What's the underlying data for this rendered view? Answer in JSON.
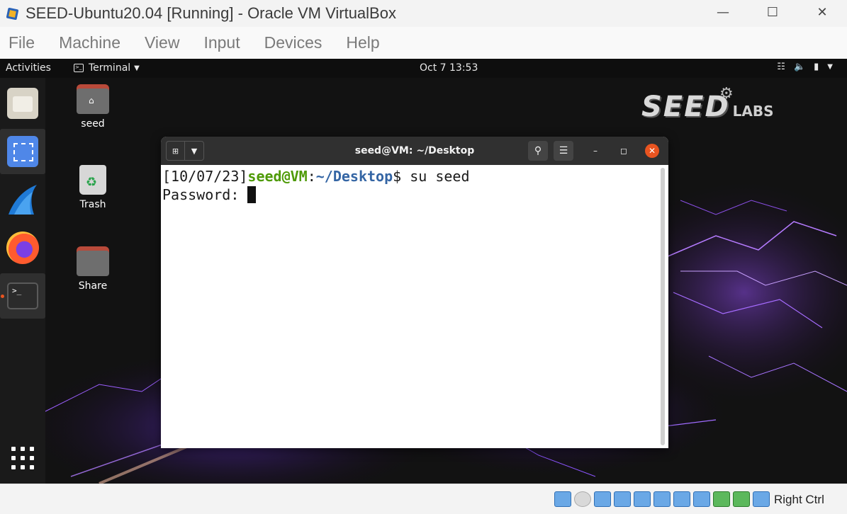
{
  "host": {
    "title": "SEED-Ubuntu20.04 [Running] - Oracle VM VirtualBox",
    "menu": [
      "File",
      "Machine",
      "View",
      "Input",
      "Devices",
      "Help"
    ],
    "status_host_key": "Right Ctrl"
  },
  "guest": {
    "topbar": {
      "activities": "Activities",
      "app_menu": "Terminal",
      "clock": "Oct 7  13:53"
    },
    "dock": {
      "items": [
        "files-icon",
        "screenshot-icon",
        "wireshark-icon",
        "firefox-icon",
        "terminal-icon"
      ],
      "show_apps": "apps-grid-icon"
    },
    "desktop": {
      "icons": [
        {
          "label": "seed",
          "icon": "home-folder-icon"
        },
        {
          "label": "Trash",
          "icon": "trash-icon"
        },
        {
          "label": "Share",
          "icon": "folder-icon"
        }
      ],
      "logo_main": "SEED",
      "logo_sub": "LABS"
    },
    "terminal": {
      "title": "seed@VM: ~/Desktop",
      "lines": {
        "date": "[10/07/23]",
        "user_host": "seed@VM",
        "colon": ":",
        "path": "~/Desktop",
        "command": "$ su seed",
        "password_prompt": "Password: "
      }
    }
  },
  "colors": {
    "accent_orange": "#e95420",
    "prompt_green": "#4e9a06",
    "prompt_blue": "#3465a4"
  }
}
